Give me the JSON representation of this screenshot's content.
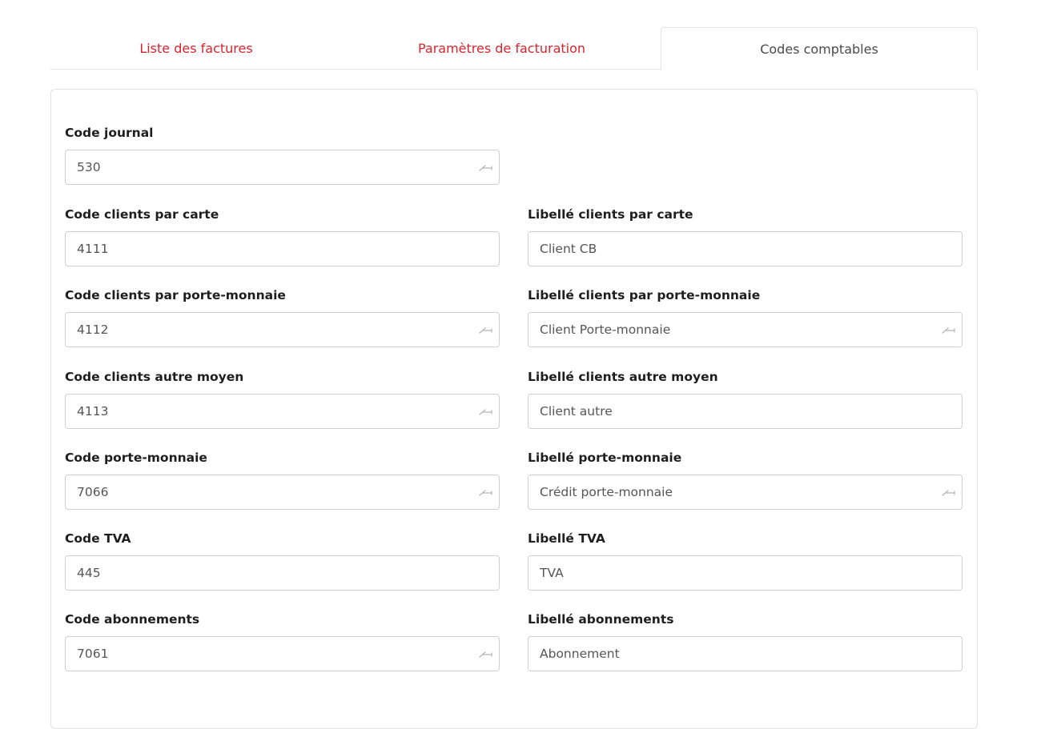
{
  "tabs": [
    {
      "label": "Liste des factures",
      "active": false
    },
    {
      "label": "Paramètres de facturation",
      "active": false
    },
    {
      "label": "Codes comptables",
      "active": true
    }
  ],
  "colors": {
    "tab_inactive": "#d9232d",
    "tab_active": "#4a4a4a",
    "border": "#e3e3e3",
    "input_border": "#cfcfcf"
  },
  "form": {
    "journal": {
      "label": "Code journal",
      "value": "530",
      "icon": "key-icon"
    },
    "clients_carte": {
      "code_label": "Code clients par carte",
      "code_value": "4111",
      "lib_label": "Libellé clients par carte",
      "lib_value": "Client CB"
    },
    "clients_pm": {
      "code_label": "Code clients par porte-monnaie",
      "code_value": "4112",
      "lib_label": "Libellé clients par porte-monnaie",
      "lib_value": "Client Porte-monnaie"
    },
    "clients_autre": {
      "code_label": "Code clients autre moyen",
      "code_value": "4113",
      "lib_label": "Libellé clients autre moyen",
      "lib_value": "Client autre"
    },
    "porte_monnaie": {
      "code_label": "Code porte-monnaie",
      "code_value": "7066",
      "lib_label": "Libellé porte-monnaie",
      "lib_value": "Crédit porte-monnaie"
    },
    "tva": {
      "code_label": "Code TVA",
      "code_value": "445",
      "lib_label": "Libellé TVA",
      "lib_value": "TVA"
    },
    "abonnements": {
      "code_label": "Code abonnements",
      "code_value": "7061",
      "lib_label": "Libellé abonnements",
      "lib_value": "Abonnement"
    }
  }
}
